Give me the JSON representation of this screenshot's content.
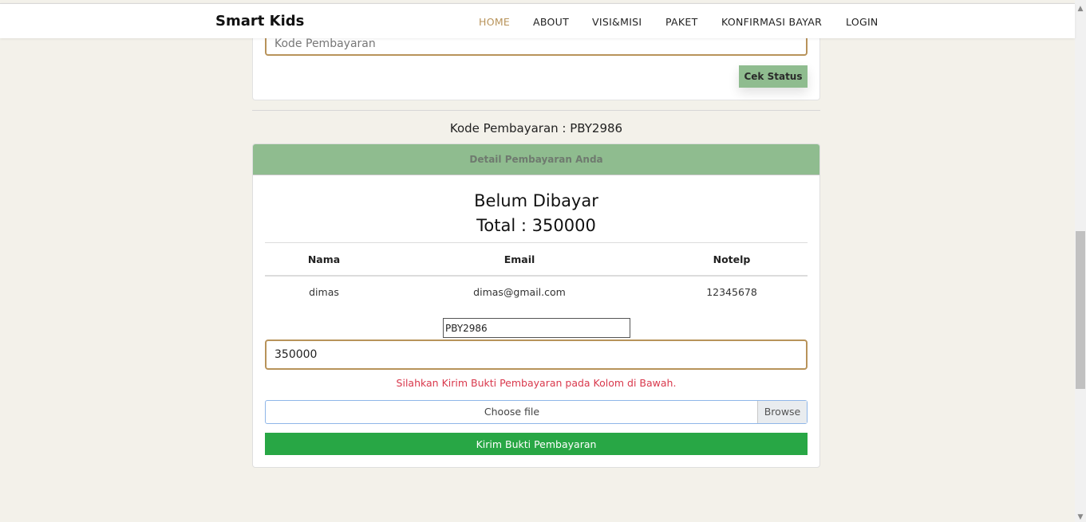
{
  "navbar": {
    "brand": "Smart Kids",
    "items": [
      {
        "label": "HOME",
        "active": true
      },
      {
        "label": "ABOUT"
      },
      {
        "label": "VISI&MISI"
      },
      {
        "label": "PAKET"
      },
      {
        "label": "KONFIRMASI BAYAR"
      },
      {
        "label": "LOGIN"
      }
    ]
  },
  "status_check": {
    "input_placeholder": "Kode Pembayaran",
    "button_label": "Cek Status"
  },
  "payment": {
    "code_heading": "Kode Pembayaran : PBY2986",
    "card_header": "Detail Pembayaran Anda",
    "status": "Belum Dibayar",
    "total": "Total : 350000",
    "table": {
      "headers": [
        "Nama",
        "Email",
        "Notelp"
      ],
      "rows": [
        [
          "dimas",
          "dimas@gmail.com",
          "12345678"
        ]
      ]
    },
    "code_value": "PBY2986",
    "amount_value": "350000",
    "info_message": "Silahkan Kirim Bukti Pembayaran pada Kolom di Bawah.",
    "file_label": "Choose file",
    "browse_label": "Browse",
    "submit_label": "Kirim Bukti Pembayaran"
  },
  "colors": {
    "accent": "#b8935a",
    "header_green": "#8fbc8f",
    "submit_green": "#28a745",
    "warning_red": "#d9384c",
    "page_bg": "#f3f1ea"
  }
}
